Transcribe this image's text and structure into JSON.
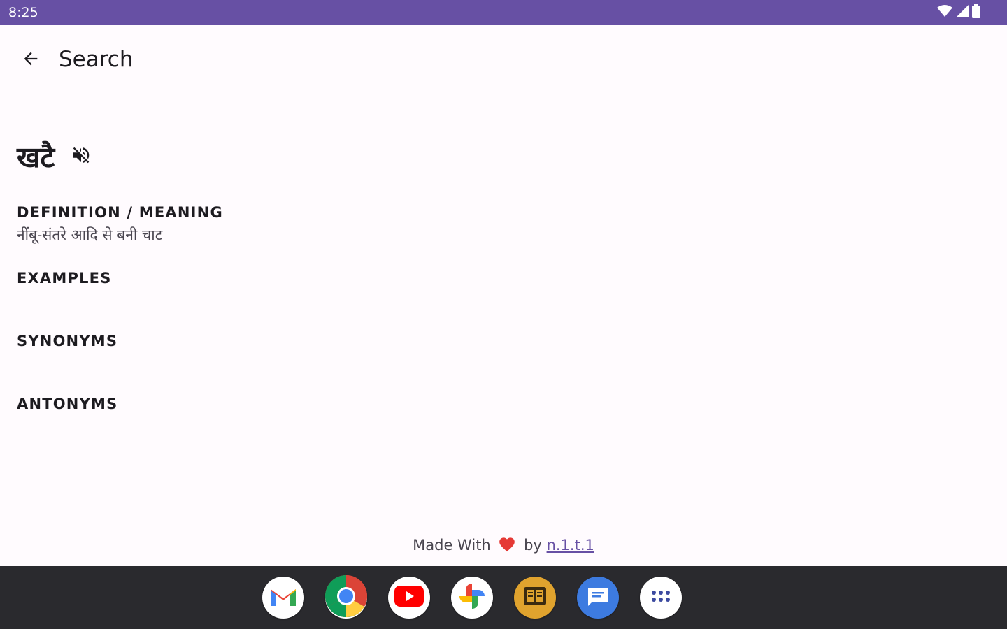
{
  "status_bar": {
    "time": "8:25",
    "icons": [
      "wifi-icon",
      "signal-icon",
      "battery-icon"
    ],
    "background": "#6750a4"
  },
  "app_bar": {
    "back_icon": "arrow-back-icon",
    "title": "Search"
  },
  "entry": {
    "word": "खटै",
    "speaker_icon": "volume-off-icon"
  },
  "sections": {
    "definition": {
      "heading": "DEFINITION / MEANING",
      "text": "नींबू-संतरे आदि से बनी चाट"
    },
    "examples": {
      "heading": "EXAMPLES"
    },
    "synonyms": {
      "heading": "SYNONYMS"
    },
    "antonyms": {
      "heading": "ANTONYMS"
    }
  },
  "footer": {
    "made_with": "Made With",
    "heart_icon": "heart-icon",
    "by": "by",
    "author": "n.1.t.1",
    "heart_color": "#e53935",
    "link_color": "#6750a4"
  },
  "dock": {
    "apps": [
      {
        "name": "Gmail",
        "icon": "gmail-icon"
      },
      {
        "name": "Chrome",
        "icon": "chrome-icon"
      },
      {
        "name": "YouTube",
        "icon": "youtube-icon"
      },
      {
        "name": "Photos",
        "icon": "photos-icon"
      },
      {
        "name": "Dictionary",
        "icon": "dictionary-app-icon"
      },
      {
        "name": "Messages",
        "icon": "messages-icon"
      },
      {
        "name": "All apps",
        "icon": "app-drawer-icon"
      }
    ]
  }
}
